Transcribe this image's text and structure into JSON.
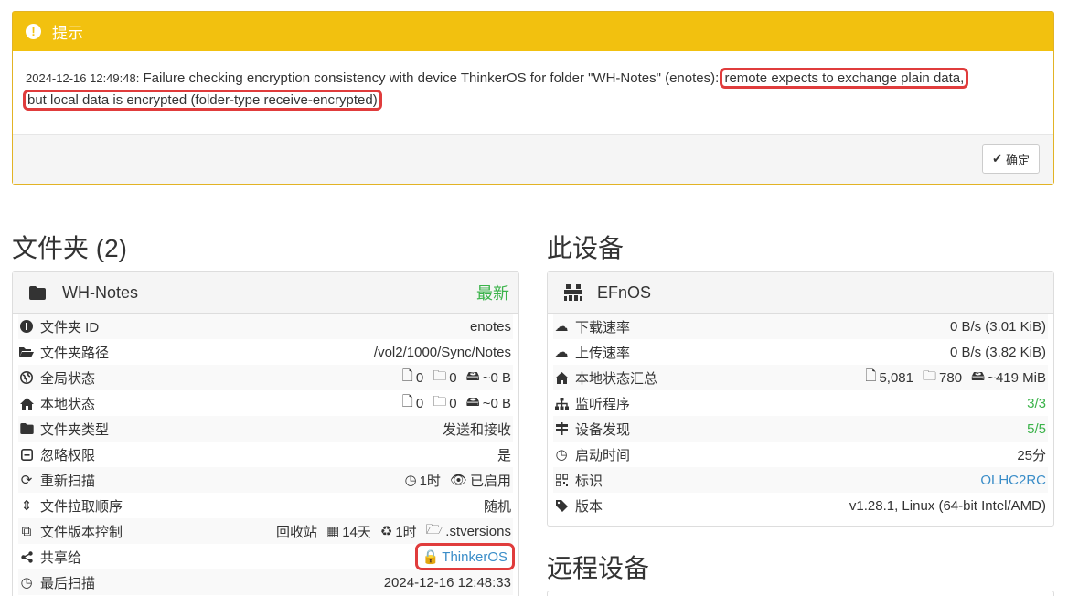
{
  "alert": {
    "title": "提示",
    "timestamp": "2024-12-16 12:49:48:",
    "message_start": " Failure checking encryption consistency with device ThinkerOS for folder \"WH-Notes\" (enotes):",
    "message_highlight_1": "remote expects to exchange plain data,",
    "message_highlight_2": "but local data is encrypted (folder-type receive-encrypted)",
    "ok_label": "确定"
  },
  "folders": {
    "heading": "文件夹 (2)",
    "panel": {
      "name": "WH-Notes",
      "status": "最新",
      "rows": [
        {
          "label": "文件夹 ID",
          "value": "enotes"
        },
        {
          "label": "文件夹路径",
          "value": "/vol2/1000/Sync/Notes"
        },
        {
          "label": "全局状态",
          "files": "0",
          "dirs": "0",
          "size": "~0 B"
        },
        {
          "label": "本地状态",
          "files": "0",
          "dirs": "0",
          "size": "~0 B"
        },
        {
          "label": "文件夹类型",
          "value": "发送和接收"
        },
        {
          "label": "忽略权限",
          "value": "是"
        },
        {
          "label": "重新扫描",
          "interval": "1时",
          "watcher": "已启用"
        },
        {
          "label": "文件拉取顺序",
          "value": "随机"
        },
        {
          "label": "文件版本控制",
          "type": "回收站",
          "keep": "14天",
          "cleanup": "1时",
          "path": ".stversions"
        },
        {
          "label": "共享给",
          "value": "ThinkerOS"
        },
        {
          "label": "最后扫描",
          "value": "2024-12-16 12:48:33"
        }
      ]
    }
  },
  "this_device": {
    "heading": "此设备",
    "panel": {
      "name": "EFnOS",
      "rows": [
        {
          "label": "下载速率",
          "value": "0 B/s (3.01 KiB)"
        },
        {
          "label": "上传速率",
          "value": "0 B/s (3.82 KiB)"
        },
        {
          "label": "本地状态汇总",
          "files": "5,081",
          "dirs": "780",
          "size": "~419 MiB"
        },
        {
          "label": "监听程序",
          "value": "3/3"
        },
        {
          "label": "设备发现",
          "value": "5/5"
        },
        {
          "label": "启动时间",
          "value": "25分"
        },
        {
          "label": "标识",
          "value": "OLHC2RC"
        },
        {
          "label": "版本",
          "value": "v1.28.1, Linux (64-bit Intel/AMD)"
        }
      ]
    }
  },
  "remote": {
    "heading": "远程设备"
  },
  "colors": {
    "alert_yellow": "#f2c10f",
    "green": "#3bb34a",
    "link": "#3a8dc8",
    "highlight": "#e03c3c"
  }
}
